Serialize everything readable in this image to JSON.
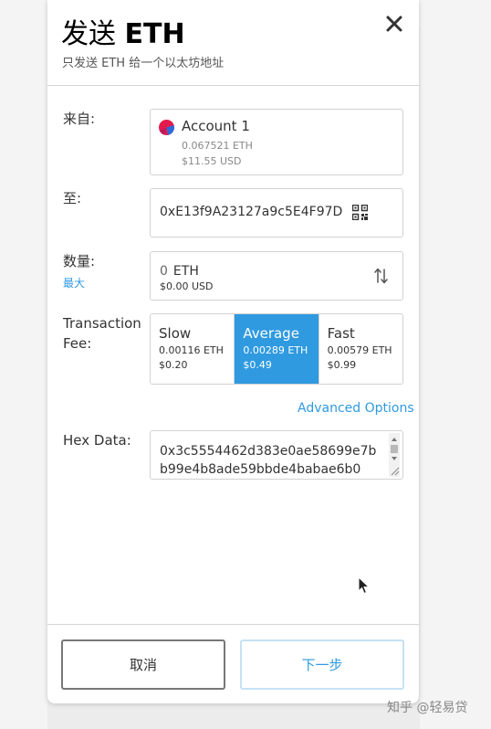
{
  "header": {
    "title_cn": "发送",
    "title_token": "ETH",
    "subtitle": "只发送 ETH 给一个以太坊地址"
  },
  "from": {
    "label": "来自:",
    "account_name": "Account 1",
    "balance_eth": "0.067521 ETH",
    "balance_usd": "$11.55 USD"
  },
  "to": {
    "label": "至:",
    "address": "0xE13f9A23127a9c5E4F97D"
  },
  "amount": {
    "label": "数量:",
    "max_label": "最大",
    "value": "0",
    "unit": "ETH",
    "usd": "$0.00 USD"
  },
  "fee": {
    "label_line1": "Transaction",
    "label_line2": "Fee:",
    "options": [
      {
        "name": "Slow",
        "eth": "0.00116 ETH",
        "usd": "$0.20",
        "selected": false
      },
      {
        "name": "Average",
        "eth": "0.00289 ETH",
        "usd": "$0.49",
        "selected": true
      },
      {
        "name": "Fast",
        "eth": "0.00579 ETH",
        "usd": "$0.99",
        "selected": false
      }
    ],
    "advanced_label": "Advanced Options"
  },
  "hex": {
    "label": "Hex Data:",
    "value": "0x3c5554462d383e0ae58699e7bb99e4b8ade59bbde4babae6b0"
  },
  "footer": {
    "cancel_label": "取消",
    "next_label": "下一步"
  },
  "watermark": "知乎 @轻易贷",
  "colors": {
    "accent": "#2f9ae0",
    "selected_fee_bg": "#2f9ae0"
  }
}
